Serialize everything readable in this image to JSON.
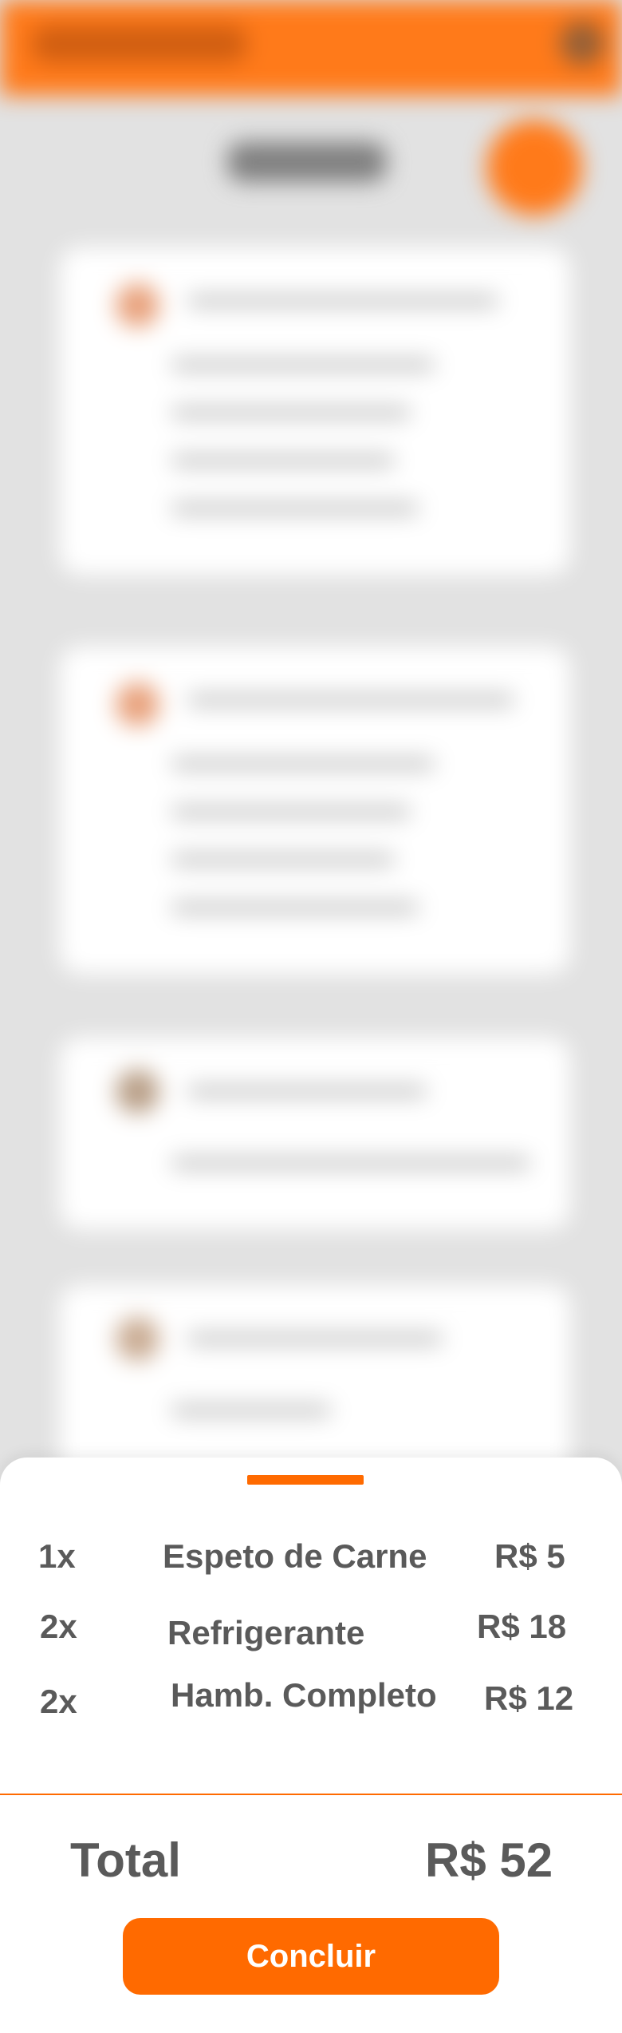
{
  "sheet": {
    "items": [
      {
        "qty": "1x",
        "name": "Espeto de Carne",
        "price": "R$ 5"
      },
      {
        "qty": "2x",
        "name": "Refrigerante",
        "price": "R$ 18"
      },
      {
        "qty": "2x",
        "name": "Hamb. Completo",
        "price": "R$ 12"
      }
    ],
    "total_label": "Total",
    "total_value": "R$ 52",
    "conclude_label": "Concluir"
  },
  "colors": {
    "accent": "#ff6a00",
    "text": "#5a5a5a",
    "background": "#e2e2e2"
  }
}
